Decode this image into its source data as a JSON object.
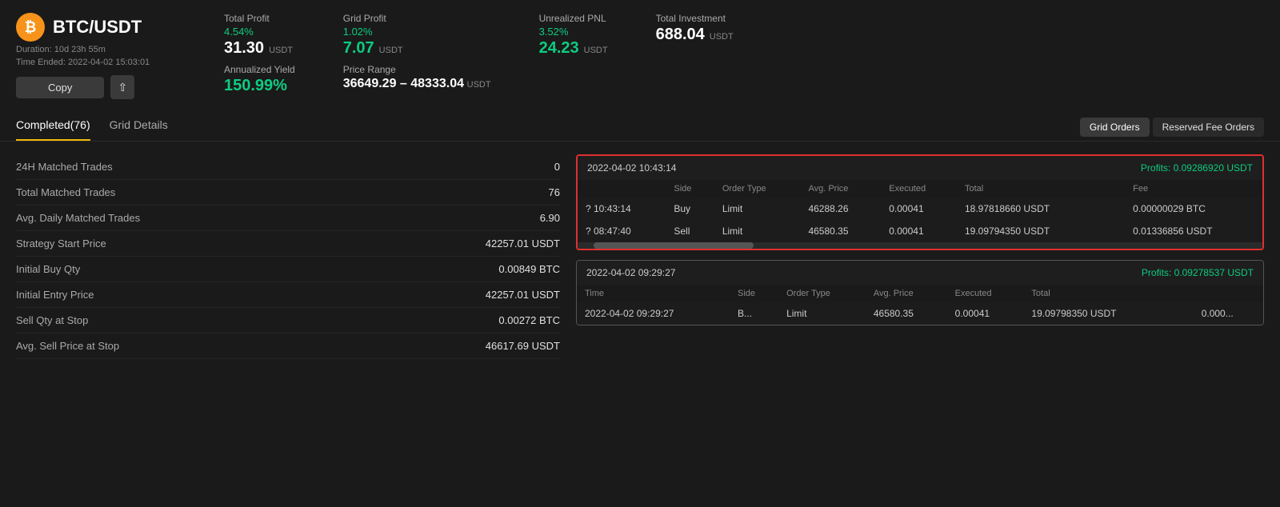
{
  "header": {
    "icon_symbol": "₿",
    "pair": "BTC/USDT",
    "duration_label": "Duration:",
    "duration_value": "10d 23h 55m",
    "time_ended_label": "Time Ended:",
    "time_ended_value": "2022-04-02 15:03:01",
    "copy_btn": "Copy",
    "share_icon": "⇧"
  },
  "stats": {
    "total_profit_label": "Total Profit",
    "total_profit_pct": "4.54%",
    "total_profit_value": "31.30",
    "total_profit_unit": "USDT",
    "grid_profit_label": "Grid Profit",
    "grid_profit_pct": "1.02%",
    "grid_profit_value": "7.07",
    "grid_profit_unit": "USDT",
    "unrealized_pnl_label": "Unrealized PNL",
    "unrealized_pnl_pct": "3.52%",
    "unrealized_pnl_value": "24.23",
    "unrealized_pnl_unit": "USDT",
    "total_investment_label": "Total Investment",
    "total_investment_value": "688.04",
    "total_investment_unit": "USDT",
    "annualized_yield_label": "Annualized Yield",
    "annualized_yield_value": "150.99%",
    "price_range_label": "Price Range",
    "price_range_value": "36649.29 – 48333.04",
    "price_range_unit": "USDT"
  },
  "tabs": {
    "left": [
      {
        "label": "Completed(76)",
        "active": true
      },
      {
        "label": "Grid Details",
        "active": false
      }
    ],
    "right": [
      {
        "label": "Grid Orders",
        "active": true
      },
      {
        "label": "Reserved Fee Orders",
        "active": false
      }
    ]
  },
  "left_stats": [
    {
      "label": "24H Matched Trades",
      "value": "0"
    },
    {
      "label": "Total Matched Trades",
      "value": "76"
    },
    {
      "label": "Avg. Daily Matched Trades",
      "value": "6.90"
    },
    {
      "label": "Strategy Start Price",
      "value": "42257.01 USDT"
    },
    {
      "label": "Initial Buy Qty",
      "value": "0.00849 BTC"
    },
    {
      "label": "Initial Entry Price",
      "value": "42257.01 USDT"
    },
    {
      "label": "Sell Qty at Stop",
      "value": "0.00272 BTC"
    },
    {
      "label": "Avg. Sell Price at Stop",
      "value": "46617.69 USDT"
    }
  ],
  "trade_groups": [
    {
      "date": "2022-04-02 10:43:14",
      "profits_label": "Profits:",
      "profits_value": "0.09286920 USDT",
      "highlighted": true,
      "columns": [
        "",
        "Side",
        "Order Type",
        "Avg. Price",
        "Executed",
        "Total",
        "",
        "Fee"
      ],
      "rows": [
        {
          "time": "? 10:43:14",
          "side": "Buy",
          "side_class": "side-buy",
          "order_type": "Limit",
          "avg_price": "46288.26",
          "executed": "0.00041",
          "total": "18.97818660 USDT",
          "fee": "0.00000029 BTC"
        },
        {
          "time": "? 08:47:40",
          "side": "Sell",
          "side_class": "side-sell",
          "order_type": "Limit",
          "avg_price": "46580.35",
          "executed": "0.00041",
          "total": "19.09794350 USDT",
          "fee": "0.01336856 USDT"
        }
      ]
    },
    {
      "date": "2022-04-02 09:29:27",
      "profits_label": "Profits:",
      "profits_value": "0.09278537 USDT",
      "highlighted": false,
      "columns": [
        "Time",
        "Side",
        "Order Type",
        "Avg. Price",
        "Executed",
        "Total",
        "",
        ""
      ],
      "rows": [
        {
          "time": "2022-04-02 09:29:27",
          "side": "B...",
          "side_class": "side-buy",
          "order_type": "Limit",
          "avg_price": "46580.35",
          "executed": "0.00041",
          "total": "19.09798350 USDT",
          "fee": "0.000..."
        }
      ]
    }
  ]
}
